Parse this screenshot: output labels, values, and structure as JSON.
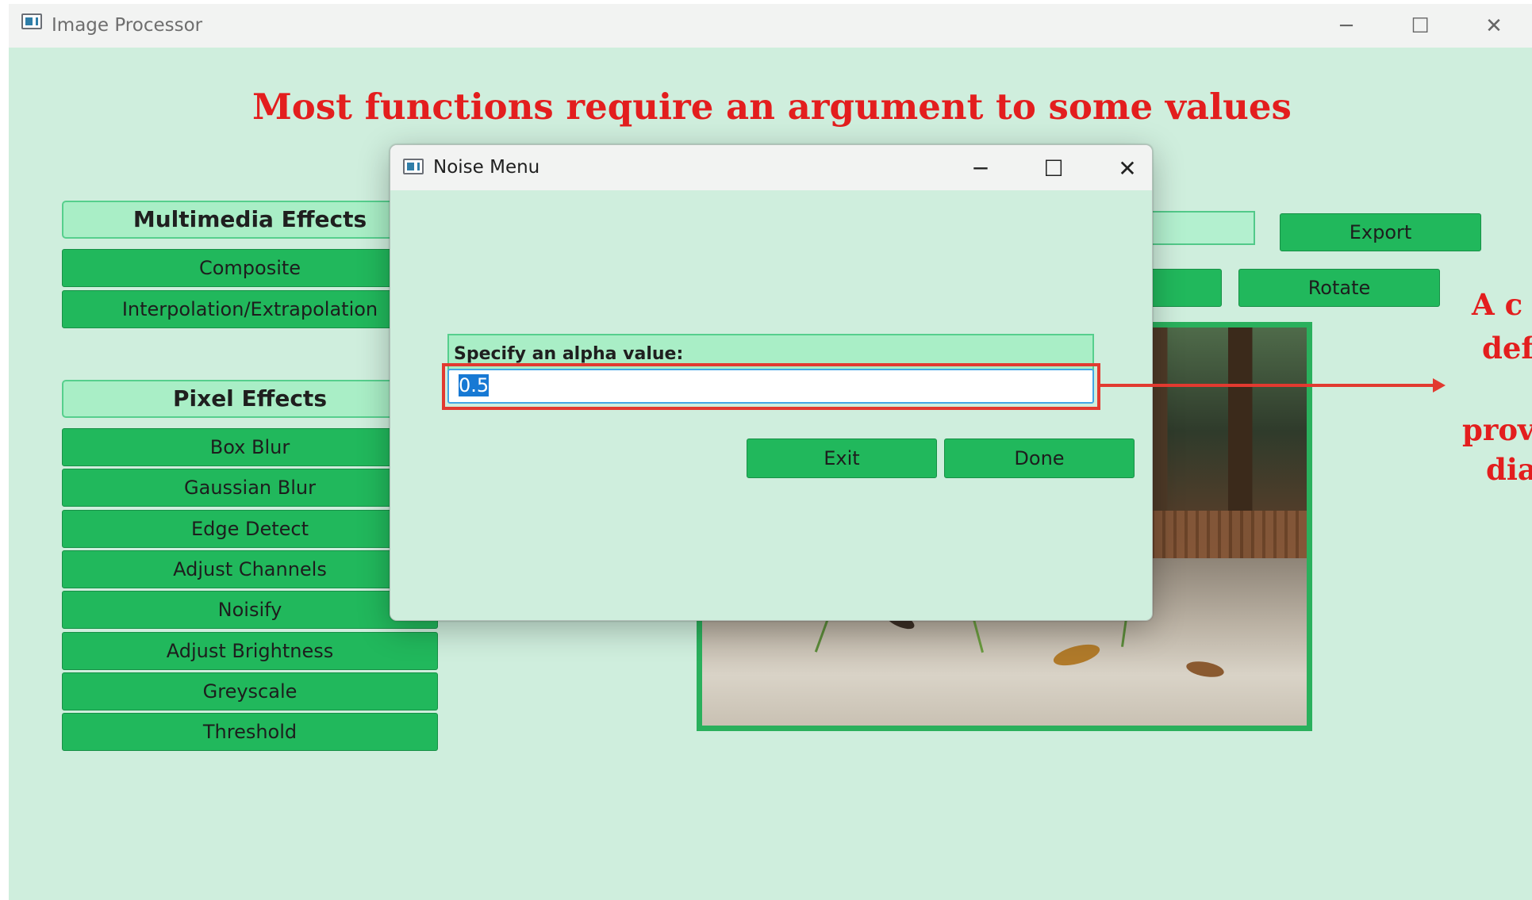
{
  "window": {
    "title": "Image Processor",
    "minimize_glyph": "─",
    "maximize_glyph": "☐",
    "close_glyph": "✕"
  },
  "heading": "Most functions require an argument to some values",
  "multimedia": {
    "title": "Multimedia Effects",
    "buttons": [
      "Composite",
      "Interpolation/Extrapolation"
    ]
  },
  "pixel": {
    "title": "Pixel Effects",
    "buttons": [
      "Box Blur",
      "Gaussian Blur",
      "Edge Detect",
      "Adjust Channels",
      "Noisify",
      "Adjust Brightness",
      "Greyscale",
      "Threshold"
    ]
  },
  "toolbar": {
    "export_label": "Export",
    "rotate_label": "Rotate"
  },
  "dialog": {
    "title": "Noise Menu",
    "field_label": "Specify an alpha value:",
    "alpha_value": "0.5",
    "exit_label": "Exit",
    "done_label": "Done"
  },
  "callout": {
    "lines": [
      "A c",
      "def",
      "prov",
      "dia"
    ]
  },
  "colors": {
    "background": "#cfeedd",
    "button_green": "#21b85c",
    "annotation_red": "#e31e1e"
  },
  "icons": {
    "app": "window-app-icon",
    "dialog": "window-app-icon"
  }
}
